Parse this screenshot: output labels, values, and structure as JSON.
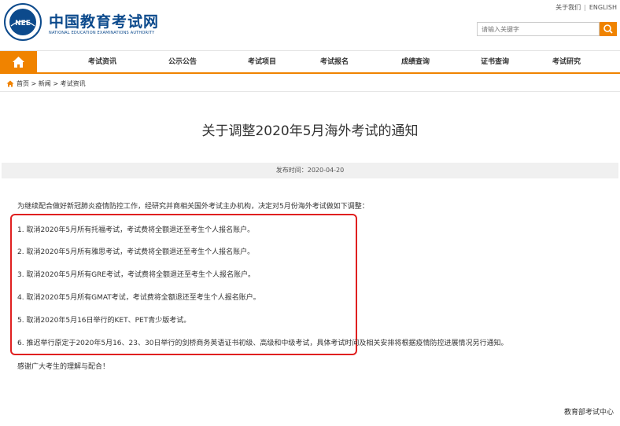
{
  "header": {
    "logo_cn": "中国教育考试网",
    "logo_en": "NATIONAL EDUCATION EXAMINATIONS AUTHORITY",
    "seal_text": "NEE",
    "toplinks": [
      "关于我们",
      "ENGLISH"
    ],
    "search_placeholder": "请输入关键字"
  },
  "nav": {
    "items": [
      "考试资讯",
      "公示公告",
      "考试项目",
      "考试报名",
      "成绩查询",
      "证书查询",
      "考试研究"
    ]
  },
  "breadcrumb": [
    "首页",
    "新闻",
    "考试资讯"
  ],
  "article": {
    "title": "关于调整2020年5月海外考试的通知",
    "date_label": "发布时间：2020-04-20",
    "intro": "为继续配合做好新冠肺炎疫情防控工作，经研究并商相关国外考试主办机构，决定对5月份海外考试做如下调整：",
    "items": [
      "1. 取消2020年5月所有托福考试，考试费将全额退还至考生个人报名账户。",
      "2. 取消2020年5月所有雅思考试，考试费将全额退还至考生个人报名账户。",
      "3. 取消2020年5月所有GRE考试，考试费将全额退还至考生个人报名账户。",
      "4. 取消2020年5月所有GMAT考试，考试费将全额退还至考生个人报名账户。",
      "5. 取消2020年5月16日举行的KET、PET青少版考试。",
      "6. 推迟举行原定于2020年5月16、23、30日举行的剑桥商务英语证书初级、高级和中级考试，具体考试时间及相关安排将根据疫情防控进展情况另行通知。"
    ],
    "thanks": "感谢广大考生的理解与配合！",
    "signature": "教育部考试中心"
  },
  "colors": {
    "brand_blue": "#0c4a8c",
    "accent_orange": "#f08300",
    "highlight_red": "#e02020"
  },
  "icons": {
    "home_nav": "home-icon",
    "search": "search-icon",
    "breadcrumb_home": "home-icon"
  }
}
